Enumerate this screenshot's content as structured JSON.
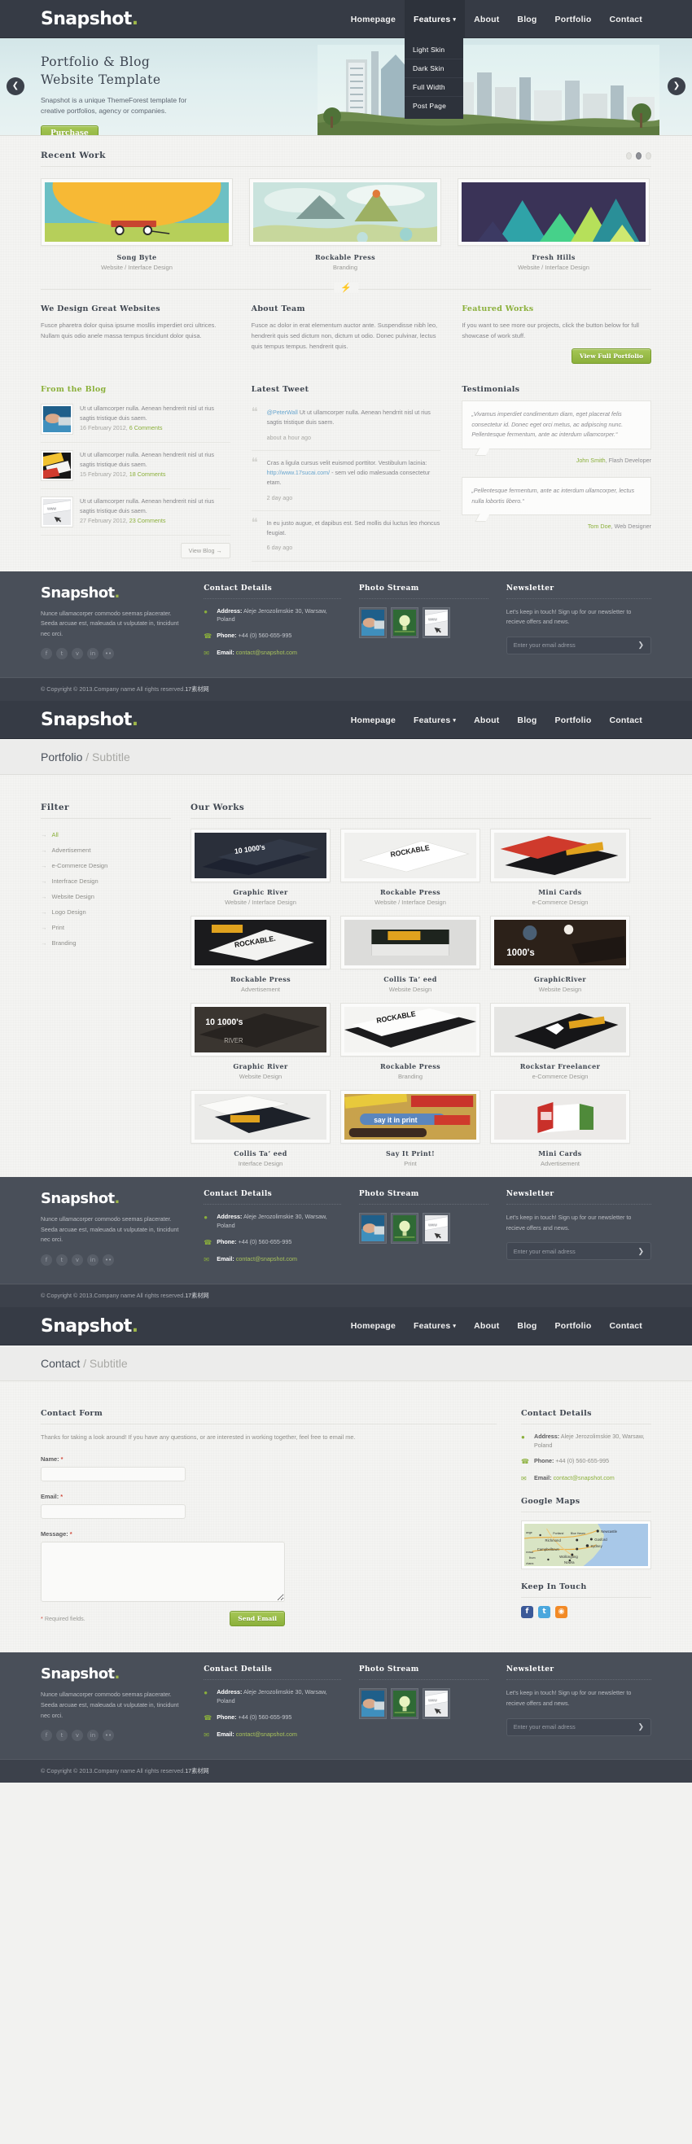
{
  "brand": {
    "name": "Snapshot",
    "dot": "."
  },
  "nav": {
    "items": [
      {
        "label": "Homepage",
        "active": false
      },
      {
        "label": "Features",
        "active": true,
        "caret": "▾"
      },
      {
        "label": "About",
        "active": false
      },
      {
        "label": "Blog",
        "active": false
      },
      {
        "label": "Portfolio",
        "active": false
      },
      {
        "label": "Contact",
        "active": false
      }
    ],
    "dropdown": [
      "Light Skin",
      "Dark Skin",
      "Full Width",
      "Post Page"
    ]
  },
  "hero": {
    "title_line1": "Portfolio & Blog",
    "title_line2": "Website Template",
    "text": "Snapshot is a unique ThemeForest template for creative portfolios, agency or companies.",
    "button": "Purchase",
    "prev_icon": "❮",
    "next_icon": "❯"
  },
  "recent_work": {
    "title": "Recent Work",
    "slider_dots": [
      false,
      true,
      false
    ],
    "items": [
      {
        "title": "Song Byte",
        "sub": "Website / Interface Design"
      },
      {
        "title": "Rockable Press",
        "sub": "Branding"
      },
      {
        "title": "Fresh Hills",
        "sub": "Website / Interface Design"
      }
    ]
  },
  "divider_icon": "⚡",
  "three_cols": [
    {
      "title": "We Design Great Websites",
      "text": "Fusce pharetra dolor quisa ipsume mosllis imperdiet orci ultrices. Nullam quis odio anele massa tempus tincidunt dolor quisa."
    },
    {
      "title": "About Team",
      "text": "Fusce ac dolor in erat elementum auctor ante. Suspendisse nibh leo, hendrerit quis sed dictum non, dictum ut odio. Donec pulvinar, lectus quis tempus tempus. hendrerit quis."
    },
    {
      "title": "Featured Works",
      "green": true,
      "text": "If you want to see more our projects, click the button below for full showcase of work stuff.",
      "button": "View Full Portfolio"
    }
  ],
  "blog": {
    "title": "From the Blog",
    "view_button": "View Blog →",
    "items": [
      {
        "text": "Ut ut ullamcorper nulla. Aenean hendrerit nisl ut rius sagtis tristique duis saem.",
        "date": "16 February 2012,",
        "comments": "6 Comments"
      },
      {
        "text": "Ut ut ullamcorper nulla. Aenean hendrerit nisl ut rius sagtis tristique duis saem.",
        "date": "15 February 2012,",
        "comments": "18 Comments"
      },
      {
        "text": "Ut ut ullamcorper nulla. Aenean hendrerit nisl ut rius sagtis tristique duis saem.",
        "date": "27 February 2012,",
        "comments": "23 Comments"
      }
    ]
  },
  "tweets": {
    "title": "Latest Tweet",
    "items": [
      {
        "handle": "@PeterWall",
        "text": " Ut ut ullamcorper nulla. Aenean hendrrit nisl ut rius sagtis tristique duis saem.",
        "ago": "about a hour ago",
        "link": ""
      },
      {
        "handle": "",
        "text": "Cras a ligula cursus velit euismod porttitor. Vestibulum lacinia: ",
        "link": "http://www.17sucai.com/",
        "after": " - sem vel odio malesuada consectetur etam.",
        "ago": "2 day ago"
      },
      {
        "handle": "",
        "text": "In eu justo augue, et dapibus est. Sed mollis dui luctus leo rhoncus feugiat.",
        "ago": "6 day ago",
        "link": ""
      }
    ]
  },
  "testimonials": {
    "title": "Testimonials",
    "items": [
      {
        "quote": "„Vivamus imperdiet condimentum diam, eget placerat felis consectetur id. Donec eget orci metus, ac adipiscing nunc. Pellentesque fermentum, ante ac interdum ullamcorper.“",
        "author": "John Smith",
        "role": ", Flash Developer"
      },
      {
        "quote": "„Pellentesque fermentum, ante ac interdum ullamcorper, lectus nulla lobortis libero.“",
        "author": "Tom Doe",
        "role": ", Web Designer"
      }
    ]
  },
  "footer": {
    "about_text": "Nunce ullamacorper commodo seemas placerater. Seeda arcuae est, maleuada ut vulputate in, tincidunt nec orci.",
    "socials": [
      "f",
      "t",
      "v",
      "in",
      "••"
    ],
    "contact": {
      "title": "Contact Details",
      "address_label": "Address:",
      "address_value": "Aleje Jerozolimskie 30, Warsaw, Poland",
      "phone_label": "Phone:",
      "phone_value": "+44 (0) 560-655-995",
      "email_label": "Email:",
      "email_value": "contact@snapshot.com"
    },
    "photostream": {
      "title": "Photo Stream"
    },
    "newsletter": {
      "title": "Newsletter",
      "text": "Let's keep in touch! Sign up for our newsletter to recieve offers and news.",
      "placeholder": "Enter your email adress",
      "go": "❯"
    }
  },
  "copyright": {
    "prefix": "© Copyright © 2013.Company name All rights reserved.",
    "cn": "17素材网"
  },
  "portfolio_page": {
    "title": "Portfolio",
    "subtitle": "/ Subtitle",
    "filter_title": "Filter",
    "filters": [
      "All",
      "Advertisement",
      "e-Commerce Design",
      "Interfrace Design",
      "Website Design",
      "Logo Design",
      "Print",
      "Branding"
    ],
    "works_title": "Our Works",
    "items": [
      {
        "title": "Graphic River",
        "sub": "Website / Interface Design"
      },
      {
        "title": "Rockable Press",
        "sub": "Website / Interface Design"
      },
      {
        "title": "Mini Cards",
        "sub": "e-Commerce Design"
      },
      {
        "title": "Rockable Press",
        "sub": "Advertisement"
      },
      {
        "title": "Collis Ta’ eed",
        "sub": "Website Design"
      },
      {
        "title": "GraphicRiver",
        "sub": "Website Design"
      },
      {
        "title": "Graphic River",
        "sub": "Website Design"
      },
      {
        "title": "Rockable Press",
        "sub": "Branding"
      },
      {
        "title": "Rockstar Freelancer",
        "sub": "e-Commerce Design"
      },
      {
        "title": "Collis Ta’ eed",
        "sub": "Interface Design"
      },
      {
        "title": "Say It Print!",
        "sub": "Print"
      },
      {
        "title": "Mini Cards",
        "sub": "Advertisement"
      }
    ]
  },
  "contact_page": {
    "title": "Contact",
    "subtitle": "/ Subtitle",
    "form_title": "Contact Form",
    "intro": "Thanks for taking a look around! If you have any questions, or are interested in working together, feel free to email me.",
    "name_label": "Name:",
    "email_label": "Email:",
    "message_label": "Message:",
    "required_star": "*",
    "required_note": "Required fields.",
    "send_button": "Send Email",
    "details_title": "Contact Details",
    "maps_title": "Google Maps",
    "keep_title": "Keep In Touch",
    "map_labels": [
      "Newcastle",
      "Gosford",
      "Sydney",
      "Richmond",
      "Campbelltown",
      "Wollongong",
      "Nowra",
      "Portland",
      "Blue Haven",
      "ange",
      "lbum",
      "xrowa",
      "vharra"
    ],
    "social_icons": [
      "f",
      "t",
      "◉"
    ]
  },
  "colors": {
    "accent_green": "#8bb03b",
    "dark_nav": "#363b45",
    "footer": "#494f59",
    "copybar": "#3c414b",
    "link_blue": "#6aa7cf",
    "required_red": "#d04a3c"
  }
}
